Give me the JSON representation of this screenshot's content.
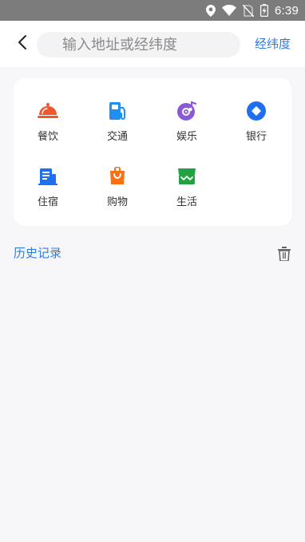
{
  "status_bar": {
    "time": "6:39",
    "icons": [
      "location-icon",
      "wifi-icon",
      "no-sim-icon",
      "battery-charging-icon"
    ]
  },
  "header": {
    "back_icon": "chevron-left-icon",
    "search_placeholder": "输入地址或经纬度",
    "coord_button_label": "经纬度"
  },
  "categories": [
    {
      "label": "餐饮",
      "icon": "dining-icon",
      "color": "#f2572b"
    },
    {
      "label": "交通",
      "icon": "gas-station-icon",
      "color": "#1f8ff2"
    },
    {
      "label": "娱乐",
      "icon": "music-disc-icon",
      "color": "#8a5ad6"
    },
    {
      "label": "银行",
      "icon": "bank-icon",
      "color": "#1f6ff2"
    },
    {
      "label": "住宿",
      "icon": "hotel-icon",
      "color": "#1f6ff2"
    },
    {
      "label": "购物",
      "icon": "shopping-bag-icon",
      "color": "#fa6e14"
    },
    {
      "label": "生活",
      "icon": "store-icon",
      "color": "#22a243"
    }
  ],
  "history": {
    "title": "历史记录",
    "clear_icon": "trash-icon"
  },
  "colors": {
    "accent": "#2d7be5",
    "background": "#f7f7fa",
    "status_bar": "#7c7c7c"
  }
}
